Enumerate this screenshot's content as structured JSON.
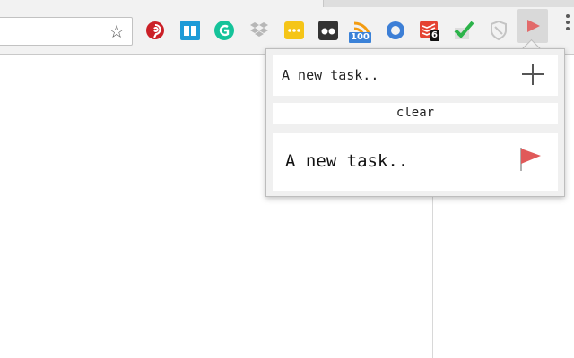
{
  "browser": {
    "omnibox": {
      "value": ""
    },
    "star_label": "☆",
    "extensions": [
      {
        "name": "pinterest-icon",
        "color": "#cb2027"
      },
      {
        "name": "reading-list-icon",
        "color": "#1da1f2"
      },
      {
        "name": "grammarly-icon",
        "color": "#15c39a"
      },
      {
        "name": "dropbox-icon",
        "color": "#b7b7b7"
      },
      {
        "name": "lastpass-icon",
        "color": "#f5c518"
      },
      {
        "name": "tab-organizer-icon",
        "color": "#333333"
      },
      {
        "name": "rss-feed-icon",
        "color": "#f39c12",
        "badge": "100"
      },
      {
        "name": "circle-extension-icon",
        "color": "#3d7fd6"
      },
      {
        "name": "todoist-icon",
        "color": "#e44332",
        "badge": "6"
      },
      {
        "name": "checkmark-icon",
        "color": "#2cb34a"
      },
      {
        "name": "shield-icon",
        "color": "#bdbdbd"
      },
      {
        "name": "flag-extension-icon",
        "color": "#e26a6a"
      }
    ]
  },
  "popup": {
    "input": {
      "value": "A new task.."
    },
    "clear_label": "clear",
    "tasks": [
      {
        "label": "A new task..",
        "flag_color": "#e05a5a"
      }
    ]
  }
}
